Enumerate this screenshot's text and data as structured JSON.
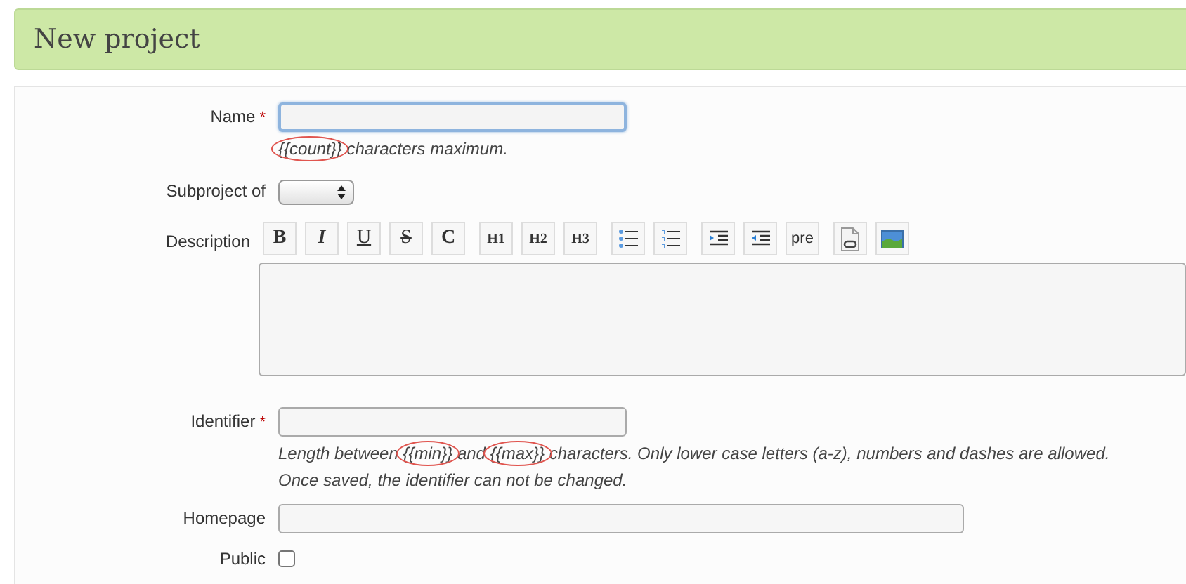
{
  "header": {
    "title": "New project"
  },
  "fields": [
    {
      "kind": "text",
      "label": "Name",
      "required_mark": "*",
      "focused": true,
      "hint": [
        [
          {
            "text": "{{count}}",
            "circled": true
          },
          {
            "text": " characters maximum.",
            "circled": false
          }
        ]
      ]
    },
    {
      "kind": "select",
      "label": "Subproject of"
    },
    {
      "kind": "editor",
      "label": "Description",
      "toolbar": [
        {
          "kind": "bold",
          "label": "B"
        },
        {
          "kind": "italic",
          "label": "I"
        },
        {
          "kind": "underline",
          "label": "U"
        },
        {
          "kind": "strike",
          "label": "S"
        },
        {
          "kind": "code",
          "label": "C"
        },
        {
          "kind": "heading",
          "label": "H1"
        },
        {
          "kind": "heading",
          "label": "H2"
        },
        {
          "kind": "heading",
          "label": "H3"
        },
        {
          "kind": "ul"
        },
        {
          "kind": "ol"
        },
        {
          "kind": "indent"
        },
        {
          "kind": "outdent"
        },
        {
          "kind": "pre",
          "label": "pre"
        },
        {
          "kind": "document"
        },
        {
          "kind": "image"
        }
      ]
    },
    {
      "kind": "text",
      "label": "Identifier",
      "required_mark": "*",
      "focused": false,
      "hint": [
        [
          {
            "text": "Length between ",
            "circled": false
          },
          {
            "text": "{{min}}",
            "circled": true
          },
          {
            "text": " and ",
            "circled": false
          },
          {
            "text": "{{max}}",
            "circled": true
          },
          {
            "text": " characters. Only lower case letters (a-z), numbers and dashes are allowed.",
            "circled": false
          }
        ],
        [
          {
            "text": "Once saved, the identifier can not be changed.",
            "circled": false
          }
        ]
      ]
    },
    {
      "kind": "wide",
      "label": "Homepage",
      "focused": false
    },
    {
      "kind": "checkbox",
      "label": "Public",
      "checked": false
    }
  ]
}
